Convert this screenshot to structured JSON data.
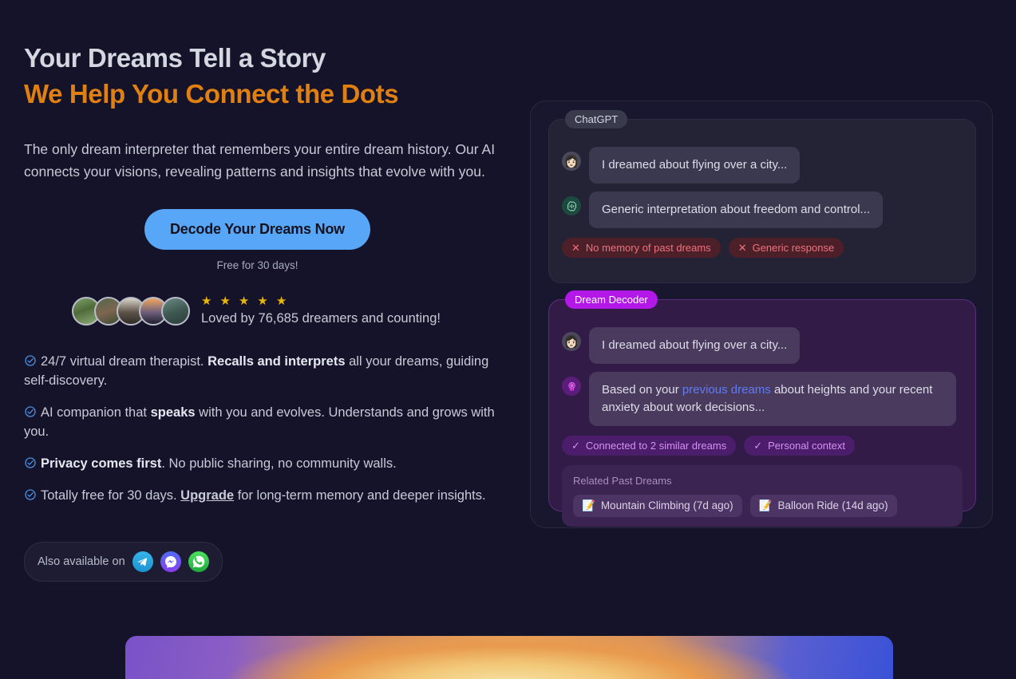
{
  "hero": {
    "headline_line1": "Your Dreams Tell a Story",
    "headline_line2": "We Help You Connect the Dots",
    "subhead": "The only dream interpreter that remembers your entire dream history. Our AI connects your visions, revealing patterns and insights that evolve with you.",
    "cta_label": "Decode Your Dreams Now",
    "cta_sub": "Free for 30 days!",
    "accent_orange": "#e08010",
    "accent_blue": "#58a6f8"
  },
  "social_proof": {
    "stars": [
      "★",
      "★",
      "★",
      "★",
      "★"
    ],
    "star_count": 5,
    "star_color": "#e8b50a",
    "loved_text": "Loved by 76,685 dreamers and counting!",
    "avatar_count": 5
  },
  "features": [
    {
      "icon": "check-circle-icon",
      "parts": [
        {
          "text": "24/7 virtual dream therapist. ",
          "style": "normal"
        },
        {
          "text": "Recalls and interprets",
          "style": "bold"
        },
        {
          "text": " all your dreams, guiding self-discovery.",
          "style": "normal"
        }
      ]
    },
    {
      "icon": "check-circle-icon",
      "parts": [
        {
          "text": "AI companion that ",
          "style": "normal"
        },
        {
          "text": "speaks",
          "style": "bold"
        },
        {
          "text": " with you and evolves. Understands and grows with you.",
          "style": "normal"
        }
      ]
    },
    {
      "icon": "check-circle-icon",
      "parts": [
        {
          "text": "Privacy comes first",
          "style": "bold"
        },
        {
          "text": ". No public sharing, no community walls.",
          "style": "normal"
        }
      ]
    },
    {
      "icon": "check-circle-icon",
      "parts": [
        {
          "text": "Totally free for 30 days. ",
          "style": "normal"
        },
        {
          "text": "Upgrade",
          "style": "link"
        },
        {
          "text": " for long-term memory and deeper insights.",
          "style": "normal"
        }
      ]
    }
  ],
  "also_available": {
    "label": "Also available on",
    "channels": [
      {
        "name": "telegram-icon",
        "color": "#29a9e8"
      },
      {
        "name": "messenger-icon",
        "color": "#6a54f2"
      },
      {
        "name": "whatsapp-icon",
        "color": "#2fc44d"
      }
    ]
  },
  "comparison": {
    "chatgpt_card": {
      "tag": "ChatGPT",
      "tag_color": "#3a3a4d",
      "messages": [
        {
          "avatar": "user-avatar",
          "emoji": "👩🏻",
          "text": "I dreamed about flying over a city..."
        },
        {
          "avatar": "openai-logo-icon",
          "emoji": "✺",
          "text": "Generic interpretation about freedom and control..."
        }
      ],
      "badges": [
        {
          "icon": "x-icon",
          "glyph": "✕",
          "label": "No memory of past dreams"
        },
        {
          "icon": "x-icon",
          "glyph": "✕",
          "label": "Generic response"
        }
      ]
    },
    "dream_decoder_card": {
      "tag": "Dream Decoder",
      "tag_color": "#b318e8",
      "messages": [
        {
          "avatar": "user-avatar",
          "emoji": "👩🏻",
          "text": "I dreamed about flying over a city..."
        },
        {
          "avatar": "dreamcatcher-icon",
          "emoji": "🪬",
          "text_before": "Based on your ",
          "link_text": "previous dreams",
          "text_after": " about heights and your recent anxiety about work decisions..."
        }
      ],
      "badges": [
        {
          "icon": "check-icon",
          "glyph": "✓",
          "label": "Connected to 2 similar dreams"
        },
        {
          "icon": "check-icon",
          "glyph": "✓",
          "label": "Personal context"
        }
      ],
      "related": {
        "title": "Related Past Dreams",
        "items": [
          {
            "icon": "notepad-icon",
            "glyph": "📝",
            "label": "Mountain Climbing (7d ago)"
          },
          {
            "icon": "notepad-icon",
            "glyph": "📝",
            "label": "Balloon Ride (14d ago)"
          }
        ]
      }
    }
  }
}
